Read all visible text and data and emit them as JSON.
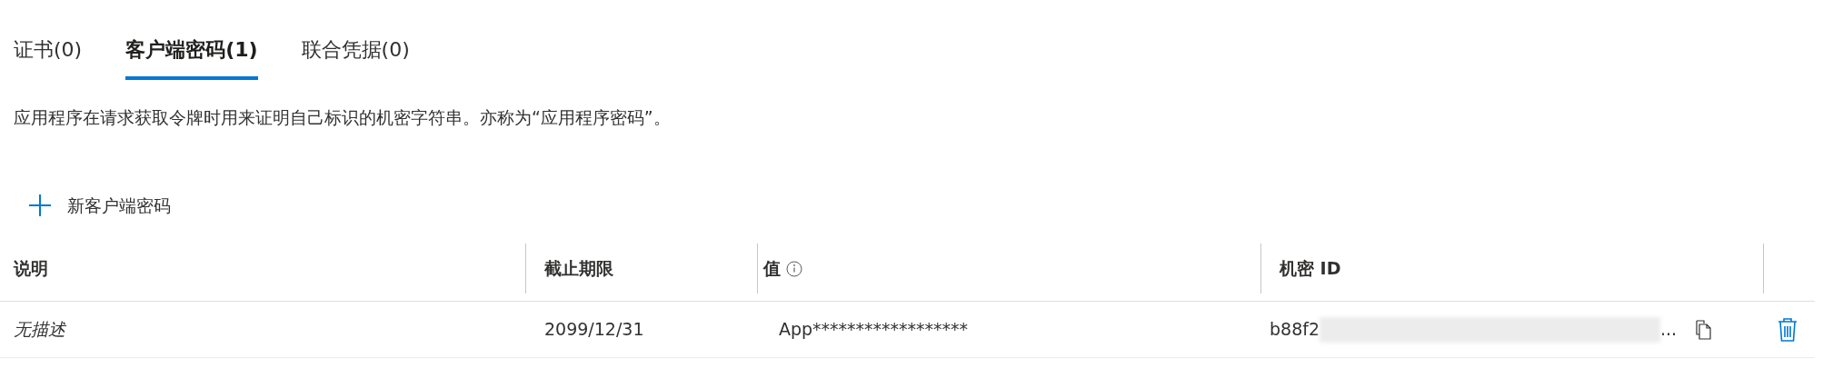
{
  "tabs": [
    {
      "label": "证书(0)",
      "selected": false
    },
    {
      "label": "客户端密码(1)",
      "selected": true
    },
    {
      "label": "联合凭据(0)",
      "selected": false
    }
  ],
  "description": "应用程序在请求获取令牌时用来证明自己标识的机密字符串。亦称为“应用程序密码”。",
  "new_button": {
    "label": "新客户端密码"
  },
  "table": {
    "columns": [
      {
        "label": "说明",
        "kind": "plain"
      },
      {
        "label": "截止期限",
        "kind": "plain"
      },
      {
        "label": "值",
        "kind": "info"
      },
      {
        "label": "机密 ID",
        "kind": "plain"
      }
    ],
    "rows": [
      {
        "description": "无描述",
        "expires": "2099/12/31",
        "value": "App******************",
        "secret_id": "b88f2",
        "secret_id_tail": "..."
      }
    ]
  }
}
